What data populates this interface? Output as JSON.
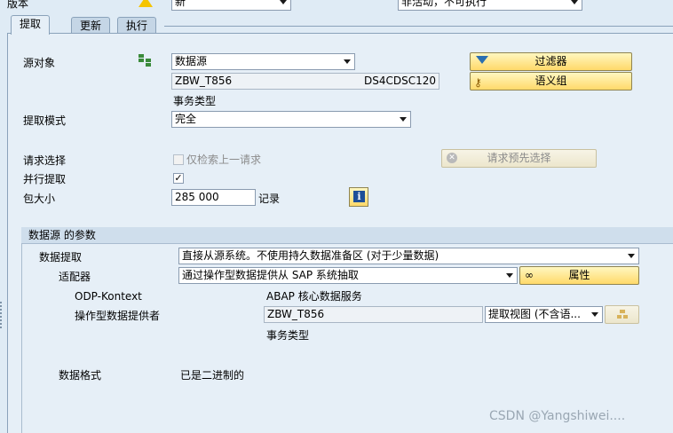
{
  "top": {
    "version_label": "版本",
    "version_value": "新",
    "status_value": "非活动，不可执行"
  },
  "tabs": [
    "提取",
    "更新",
    "执行"
  ],
  "source": {
    "label": "源对象",
    "type_value": "数据源",
    "name": "ZBW_T856",
    "tech_name": "DS4CDSC120",
    "subtype": "事务类型",
    "filter_button": "过滤器",
    "semantic_button": "语义组"
  },
  "extraction": {
    "mode_label": "提取模式",
    "mode_value": "完全",
    "request_selection_label": "请求选择",
    "only_previous_label": "仅检索上一请求",
    "request_preselect_button": "请求预先选择",
    "parallel_label": "并行提取",
    "parallel_checked": "✓",
    "package_label": "包大小",
    "package_value": "285 000",
    "records_label": "记录"
  },
  "params": {
    "title": "数据源 的参数",
    "extraction_label": "数据提取",
    "extraction_value": "直接从源系统。不使用持久数据准备区 (对于少量数据)",
    "adapter_label": "适配器",
    "adapter_value": "通过操作型数据提供从 SAP 系统抽取",
    "properties_button": "属性",
    "odp_label": "ODP-Kontext",
    "odp_value": "ABAP 核心数据服务",
    "provider_label": "操作型数据提供者",
    "provider_value": "ZBW_T856",
    "view_value": "提取视图 (不含语...",
    "provider_desc": "事务类型",
    "format_label": "数据格式",
    "format_value": "已是二进制的"
  },
  "watermark": "CSDN @Yangshiwei...."
}
